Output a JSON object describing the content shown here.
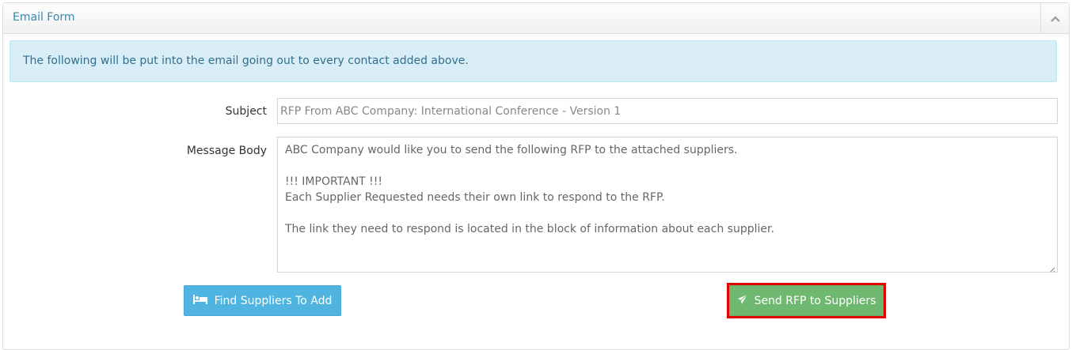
{
  "panel": {
    "title": "Email Form",
    "collapse_icon": "chevron-up-icon"
  },
  "alert": {
    "text": "The following will be put into the email going out to every contact added above."
  },
  "form": {
    "subject_label": "Subject",
    "subject_value": "RFP From ABC Company: International Conference - Version 1",
    "body_label": "Message Body",
    "body_lines": [
      "ABC Company would like you to send the following RFP to the attached suppliers.",
      "",
      "!!! IMPORTANT !!!",
      "Each Supplier Requested needs their own link to respond to the RFP.",
      "",
      "The link they need to respond is located in the block of information about each supplier."
    ]
  },
  "buttons": {
    "find_label": "Find Suppliers To Add",
    "find_icon": "bed-icon",
    "send_label": "Send RFP to Suppliers",
    "send_icon": "paper-plane-icon"
  },
  "colors": {
    "title": "#3a87ad",
    "alert_bg": "#d9edf7",
    "find_button": "#4fb4e0",
    "send_button": "#6fb86f",
    "highlight": "#e00000"
  }
}
